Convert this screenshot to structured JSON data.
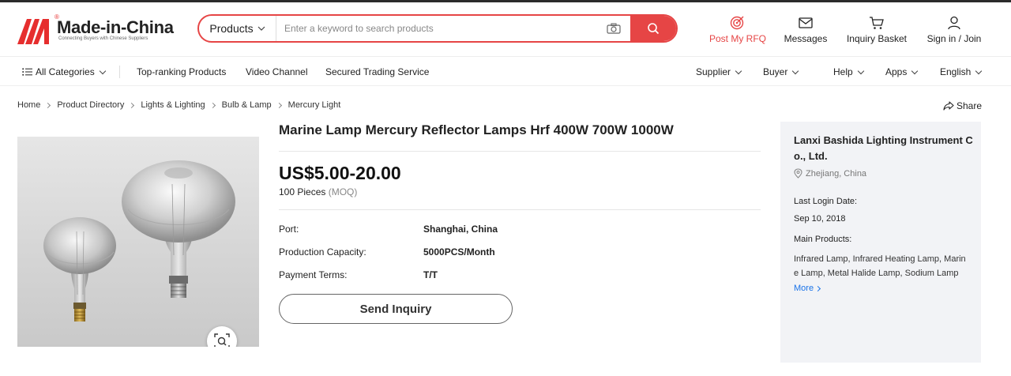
{
  "logo": {
    "text": "Made-in-China",
    "tagline": "Connecting Buyers with Chinese Suppliers",
    "reg": "®",
    "brand_color": "#e62e2e"
  },
  "search": {
    "category": "Products",
    "placeholder": "Enter a keyword to search products",
    "accent_color": "#e64545"
  },
  "header_actions": {
    "post_rfq": "Post My RFQ",
    "messages": "Messages",
    "inquiry_basket": "Inquiry Basket",
    "sign_in": "Sign in / Join"
  },
  "nav": {
    "all_categories": "All Categories",
    "top_ranking": "Top-ranking Products",
    "video_channel": "Video Channel",
    "secured_trading": "Secured Trading Service",
    "supplier": "Supplier",
    "buyer": "Buyer",
    "help": "Help",
    "apps": "Apps",
    "language": "English"
  },
  "breadcrumb": [
    "Home",
    "Product Directory",
    "Lights & Lighting",
    "Bulb & Lamp",
    "Mercury Light"
  ],
  "share_label": "Share",
  "product": {
    "title": "Marine Lamp Mercury Reflector Lamps Hrf 400W 700W 1000W",
    "price": "US$5.00-20.00",
    "moq_qty": "100 Pieces",
    "moq_label": "(MOQ)",
    "attributes": [
      {
        "label": "Port:",
        "value": "Shanghai, China"
      },
      {
        "label": "Production Capacity:",
        "value": "5000PCS/Month"
      },
      {
        "label": "Payment Terms:",
        "value": "T/T"
      }
    ],
    "inquiry_button": "Send Inquiry"
  },
  "supplier": {
    "name": "Lanxi Bashida Lighting Instrument Co., Ltd.",
    "location": "Zhejiang, China",
    "last_login_label": "Last Login Date:",
    "last_login_value": "Sep 10, 2018",
    "main_products_label": "Main Products:",
    "main_products_value": "Infrared Lamp, Infrared Heating Lamp, Marine Lamp, Metal Halide Lamp, Sodium Lamp",
    "more_label": "More"
  }
}
